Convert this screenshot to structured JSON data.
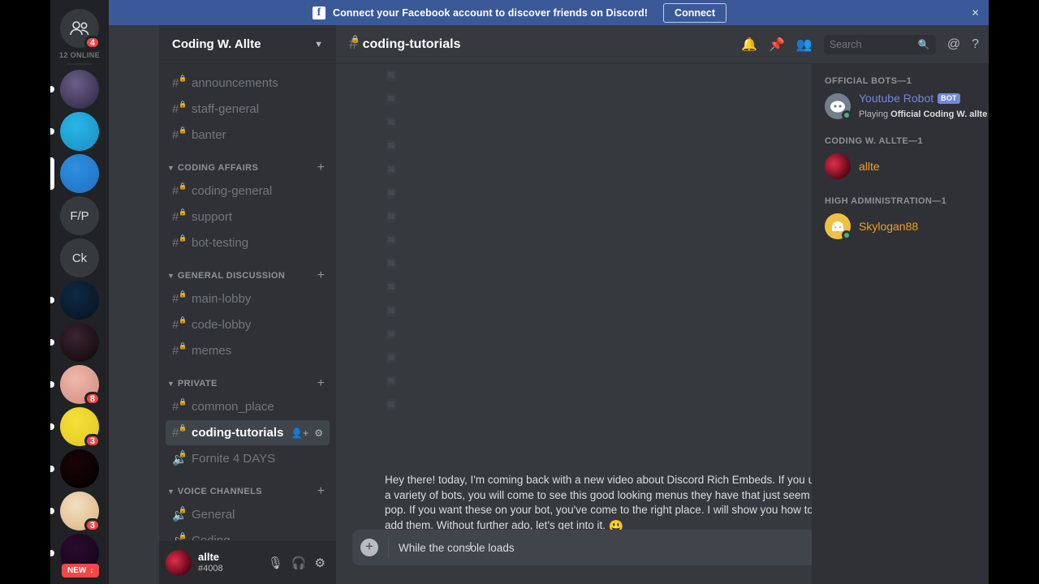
{
  "banner": {
    "icon": "facebook-icon",
    "text": "Connect your Facebook account to discover friends on Discord!",
    "button": "Connect",
    "close": "×",
    "bg_color": "#3b5998"
  },
  "rail": {
    "home_icon": "friends-icon",
    "home_badge": "4",
    "online_count": "12 ONLINE",
    "new_pill": "NEW",
    "new_pill_arrow": "↓",
    "servers": [
      {
        "name": "server-shapes",
        "initials": "",
        "badge": "",
        "selected": false,
        "unread": true,
        "color1": "#6b5f8a",
        "color2": "#2b2440"
      },
      {
        "name": "server-discord-blue",
        "initials": "",
        "badge": "",
        "selected": false,
        "unread": true,
        "color1": "#29b6e8",
        "color2": "#1a8fc0"
      },
      {
        "name": "server-coding-w-allte",
        "initials": "",
        "badge": "",
        "selected": true,
        "unread": false,
        "color1": "#2f90e0",
        "color2": "#1e6fc0"
      },
      {
        "name": "server-fp",
        "initials": "F/P",
        "badge": "",
        "selected": false,
        "unread": false,
        "color1": "#36393e",
        "color2": "#36393e"
      },
      {
        "name": "server-ck",
        "initials": "Ck",
        "badge": "",
        "selected": false,
        "unread": false,
        "color1": "#36393e",
        "color2": "#36393e"
      },
      {
        "name": "server-blue-wings",
        "initials": "",
        "badge": "",
        "selected": false,
        "unread": true,
        "color1": "#0e2a44",
        "color2": "#06111d"
      },
      {
        "name": "server-concert",
        "initials": "",
        "badge": "",
        "selected": false,
        "unread": true,
        "color1": "#3a2430",
        "color2": "#0d0608"
      },
      {
        "name": "server-face-meme",
        "initials": "",
        "badge": "8",
        "selected": false,
        "unread": true,
        "color1": "#f0b9ab",
        "color2": "#cf8a7c"
      },
      {
        "name": "server-yellow-blob",
        "initials": "",
        "badge": "3",
        "selected": false,
        "unread": true,
        "color1": "#f5e03a",
        "color2": "#e2c81f"
      },
      {
        "name": "server-lolsoft",
        "initials": "",
        "badge": "",
        "selected": false,
        "unread": true,
        "color1": "#1a0407",
        "color2": "#000000"
      },
      {
        "name": "server-nr-gold",
        "initials": "",
        "badge": "3",
        "selected": false,
        "unread": true,
        "color1": "#f3e0c0",
        "color2": "#d8b27e"
      },
      {
        "name": "server-b-pink",
        "initials": "",
        "badge": "",
        "selected": false,
        "unread": true,
        "color1": "#2a0b2e",
        "color2": "#120418"
      }
    ]
  },
  "sidebar": {
    "guild_name": "Coding W. Allte",
    "chevron": "⌄",
    "categories": [
      {
        "name": "",
        "plus": "+",
        "arrow": "",
        "channels": [
          {
            "label": "announcements",
            "type": "text",
            "locked": true,
            "selected": false
          },
          {
            "label": "staff-general",
            "type": "text",
            "locked": true,
            "selected": false
          },
          {
            "label": "banter",
            "type": "text",
            "locked": true,
            "selected": false
          }
        ]
      },
      {
        "name": "CODING AFFAIRS",
        "plus": "+",
        "arrow": "⌄",
        "channels": [
          {
            "label": "coding-general",
            "type": "text",
            "locked": true,
            "selected": false
          },
          {
            "label": "support",
            "type": "text",
            "locked": true,
            "selected": false
          },
          {
            "label": "bot-testing",
            "type": "text",
            "locked": true,
            "selected": false
          }
        ]
      },
      {
        "name": "GENERAL DISCUSSION",
        "plus": "+",
        "arrow": "⌄",
        "channels": [
          {
            "label": "main-lobby",
            "type": "text",
            "locked": true,
            "selected": false
          },
          {
            "label": "code-lobby",
            "type": "text",
            "locked": true,
            "selected": false
          },
          {
            "label": "memes",
            "type": "text",
            "locked": true,
            "selected": false
          }
        ]
      },
      {
        "name": "PRIVATE",
        "plus": "+",
        "arrow": "⌄",
        "channels": [
          {
            "label": "common_place",
            "type": "text",
            "locked": true,
            "selected": false
          },
          {
            "label": "coding-tutorials",
            "type": "text",
            "locked": true,
            "selected": true,
            "actions": [
              "invite-icon",
              "settings-icon"
            ]
          },
          {
            "label": "Fornite 4 DAYS",
            "type": "voice",
            "locked": true,
            "selected": false
          }
        ]
      },
      {
        "name": "VOICE CHANNELS",
        "plus": "+",
        "arrow": "⌄",
        "channels": [
          {
            "label": "General",
            "type": "voice",
            "locked": true,
            "selected": false
          },
          {
            "label": "Coding",
            "type": "voice",
            "locked": true,
            "selected": false
          }
        ]
      }
    ],
    "user": {
      "name": "allte",
      "tag": "#4008",
      "icons": [
        "mic-muted-icon",
        "headphones-icon",
        "settings-icon"
      ]
    }
  },
  "header": {
    "channel_name": "coding-tutorials",
    "hash": "#",
    "icons": [
      "bell-icon",
      "pin-icon",
      "members-icon"
    ],
    "search_placeholder": "Search",
    "right_icons": [
      "mentions-icon",
      "help-icon"
    ]
  },
  "chat": {
    "message": "Hey there! today, I'm coming back with a new video about Discord Rich Embeds. If you use a variety of bots, you will come to see this good looking menus they have that just seem to pop. If you want these on your bot, you've come to the right place. I will show you how to add them. Without further ado, let's get into it.",
    "message_emoji": "😃",
    "ghost_rows": 15
  },
  "composer": {
    "value": "While the console loads",
    "plus": "+",
    "emoji": "☺",
    "cursor": "I"
  },
  "members": {
    "groups": [
      {
        "title": "OFFICIAL BOTS—1",
        "people": [
          {
            "name": "Youtube Robot",
            "color": "#7289da",
            "bot": true,
            "bot_label": "BOT",
            "status": "online",
            "status_color": "#43b581",
            "activity_prefix": "Playing ",
            "activity": "Official Coding W. allte I",
            "avatar_type": "discord-logo",
            "avatar_color": "#747f8d"
          }
        ]
      },
      {
        "title": "CODING W. ALLTE—1",
        "people": [
          {
            "name": "allte",
            "color": "#f0a020",
            "bot": false,
            "status": "",
            "status_color": "#f04747",
            "activity": "",
            "avatar_type": "red-glow",
            "avatar_color": "#c0152a"
          }
        ]
      },
      {
        "title": "HIGH ADMINISTRATION—1",
        "people": [
          {
            "name": "Skylogan88",
            "color": "#f0a020",
            "bot": false,
            "status": "online",
            "status_color": "#43b581",
            "activity": "",
            "avatar_type": "yellow-face",
            "avatar_color": "#f0c040"
          }
        ]
      }
    ]
  }
}
